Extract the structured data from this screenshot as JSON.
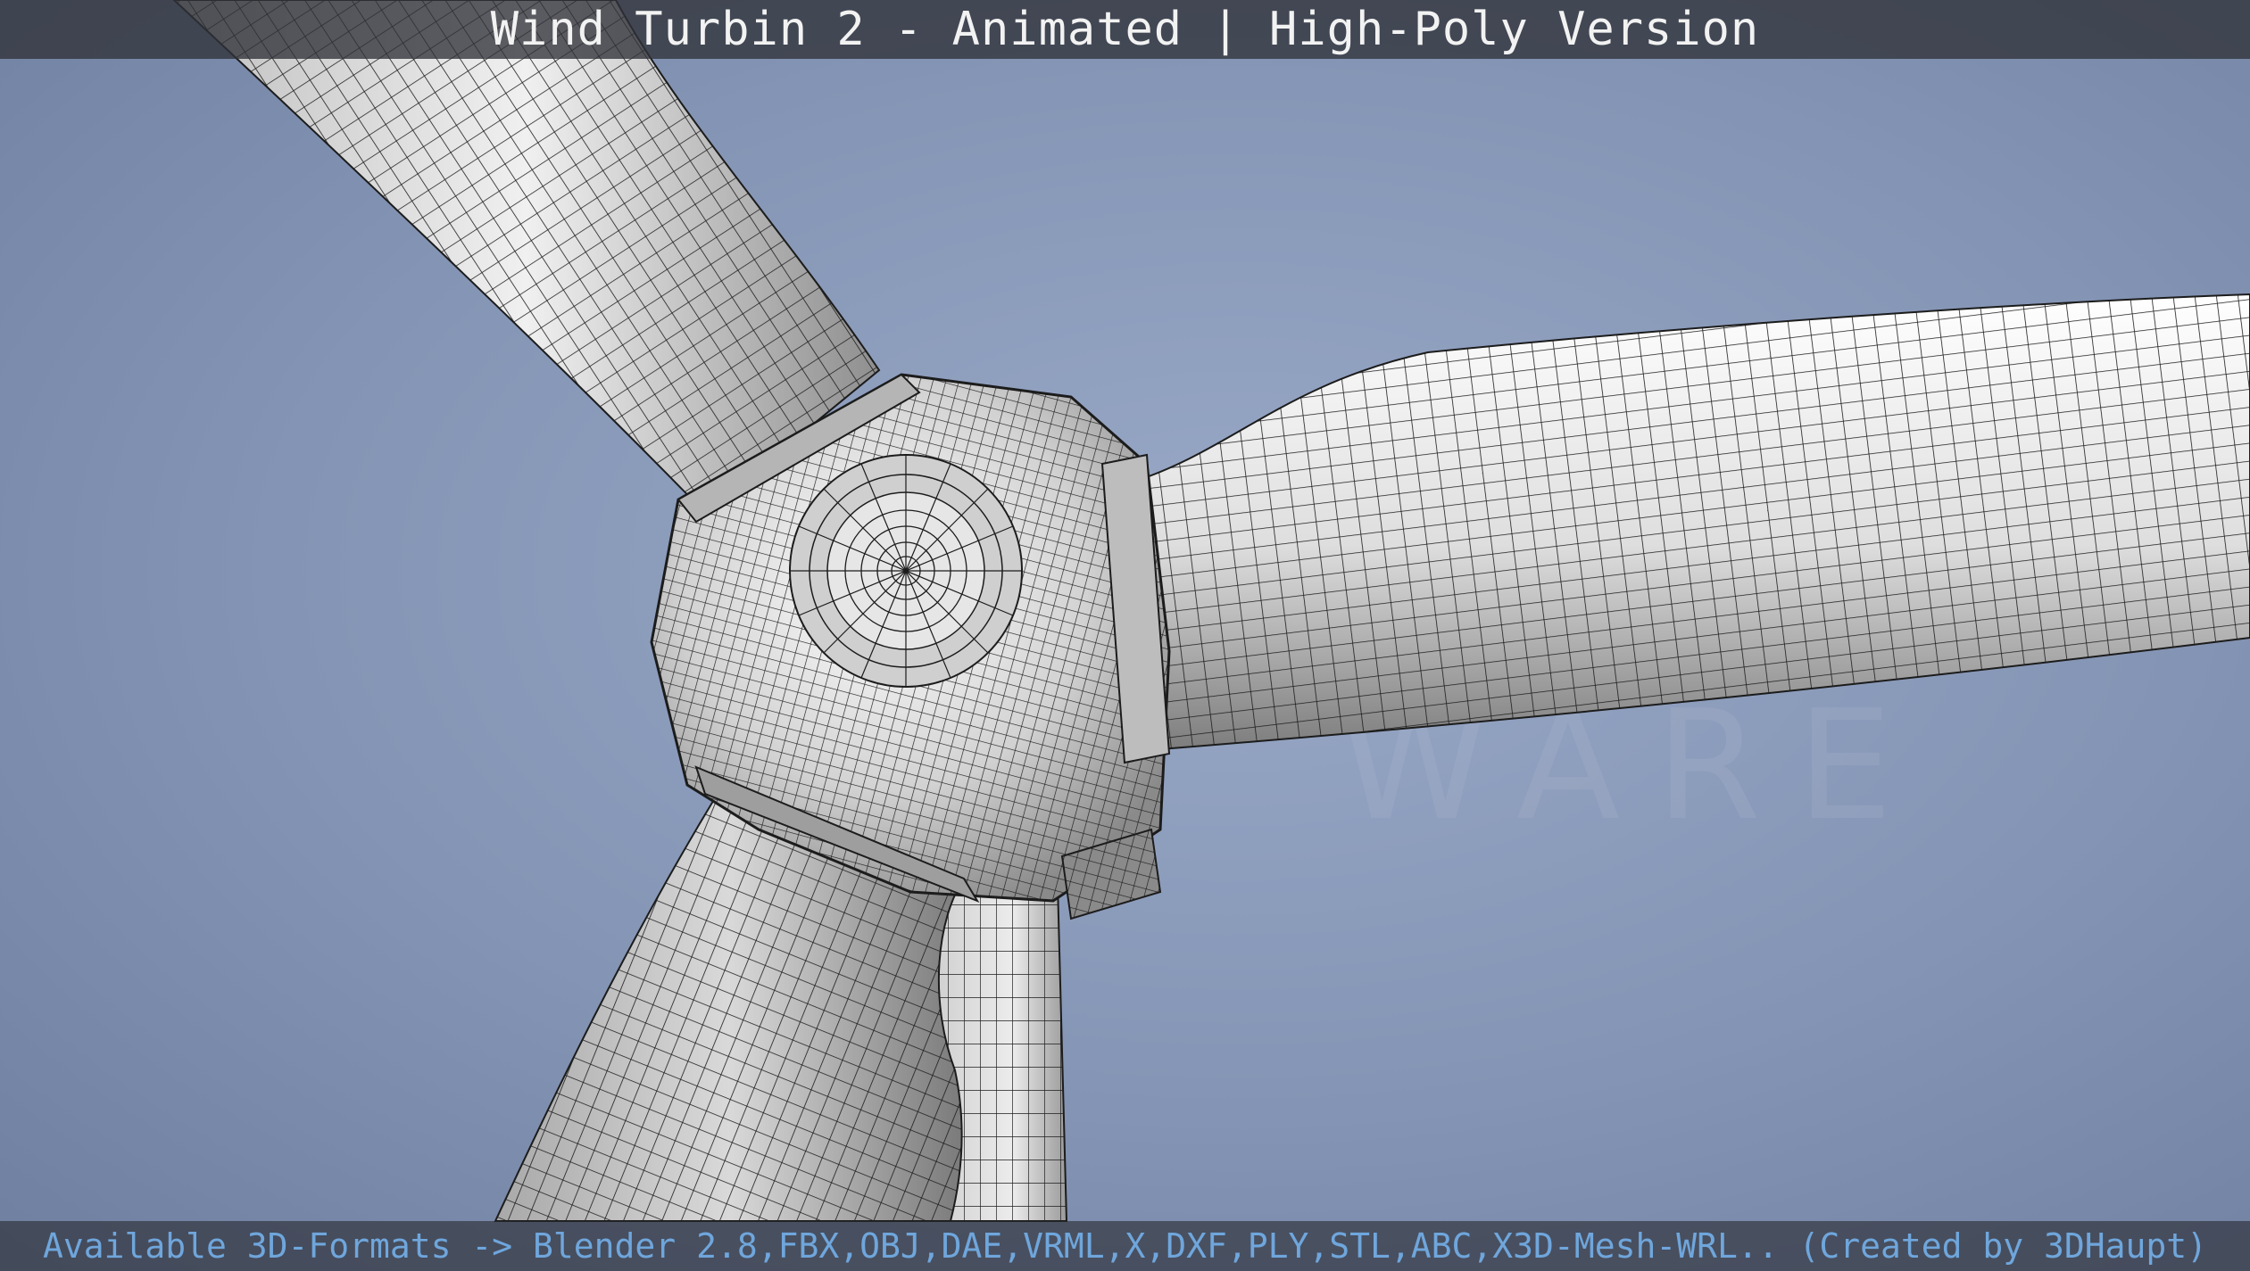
{
  "header": {
    "title": "Wind Turbin 2 - Animated | High-Poly Version"
  },
  "footer": {
    "formats_text": "Available 3D-Formats -> Blender 2.8,FBX,OBJ,DAE,VRML,X,DXF,PLY,STL,ABC,X3D-Mesh-WRL.. (Created by 3DHaupt)"
  },
  "colors": {
    "sky": "#8496b6",
    "mesh_surface": "#d8d8d8",
    "wire": "#1c1c1c",
    "title_text": "#f2f2f2",
    "footer_text": "#6fa6dc"
  }
}
